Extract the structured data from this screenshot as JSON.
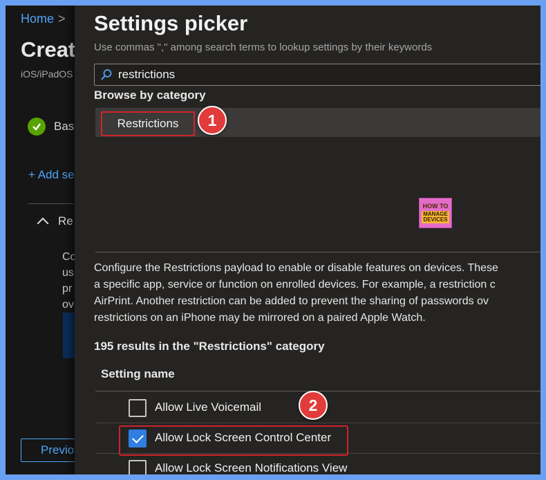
{
  "background_page": {
    "breadcrumb_home": "Home",
    "breadcrumb_separator": ">",
    "title": "Creat",
    "subtitle": "iOS/iPadOS",
    "step_basics": "Bas",
    "add_settings": "+ Add se",
    "section_label": "Re",
    "section_desc": [
      "Co",
      "us",
      "pr",
      "ov"
    ],
    "previous_button": "Previo"
  },
  "picker": {
    "title": "Settings picker",
    "hint": "Use commas \",\" among search terms to lookup settings by their keywords",
    "search": {
      "value": "restrictions",
      "icon": "search-icon"
    },
    "browse_heading": "Browse by category",
    "category": "Restrictions",
    "callout_1": "1",
    "callout_2": "2",
    "watermark_top": "HOW TO",
    "watermark_mid": "MANAGE",
    "watermark_bottom": "DEVICES",
    "category_description": [
      "Configure the Restrictions payload to enable or disable features on devices. These",
      "a specific app, service or function on enrolled devices. For example, a restriction c",
      "AirPrint. Another restriction can be added to prevent the sharing of passwords ov",
      "restrictions on an iPhone may be mirrored on a paired Apple Watch."
    ],
    "results_count": "195 results in the \"Restrictions\" category",
    "column_header": "Setting name",
    "settings": [
      {
        "label": "Allow Live Voicemail",
        "checked": false
      },
      {
        "label": "Allow Lock Screen Control Center",
        "checked": true
      },
      {
        "label": "Allow Lock Screen Notifications View",
        "checked": false
      }
    ]
  },
  "colors": {
    "accent_blue": "#4fa3f7",
    "checkbox_blue": "#2f7ee0",
    "callout_red": "#e23b3b",
    "highlight_red": "#d0232a",
    "success_green": "#57a300"
  }
}
